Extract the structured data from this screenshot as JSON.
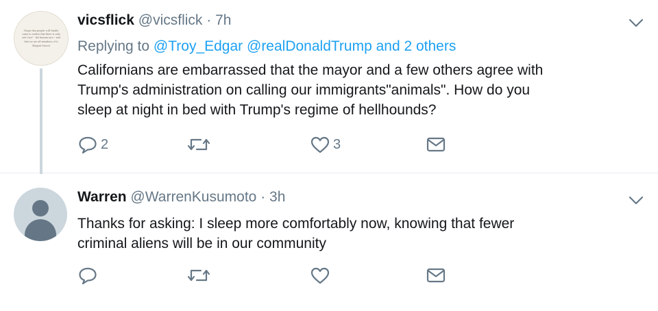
{
  "tweets": [
    {
      "name": "vicsflick",
      "handle": "@vicsflick",
      "separator": "·",
      "time": "7h",
      "replying_prefix": "Replying to",
      "replying_to": "@Troy_Edgar @realDonaldTrump and 2 others",
      "text_lines": [
        "Californians are embarrassed that the mayor and a few others agree with",
        "Trump's administration on calling our immigrants\"animals\". How do you",
        "sleep at night in bed with Trump's regime of hellhounds?"
      ],
      "avatar_quote": "I hope that people will finally come to realize that there is only one 'race' - the human race - and that we are all members of it",
      "avatar_author": "Margaret Atwood",
      "reply_count": "2",
      "retweet_count": "",
      "like_count": "3",
      "icons": [
        "reply-icon",
        "retweet-icon",
        "like-icon",
        "message-icon",
        "chevron-down-icon"
      ]
    },
    {
      "name": "Warren",
      "handle": "@WarrenKusumoto",
      "separator": "·",
      "time": "3h",
      "text_lines": [
        "Thanks for asking: I sleep more comfortably now, knowing that fewer",
        "criminal aliens will be in our community"
      ],
      "reply_count": "",
      "retweet_count": "",
      "like_count": "",
      "icons": [
        "reply-icon",
        "retweet-icon",
        "like-icon",
        "message-icon",
        "chevron-down-icon"
      ]
    }
  ],
  "colors": {
    "text": "#14171a",
    "secondary": "#657786",
    "link": "#1da1f2",
    "divider": "#e6ecf0",
    "thread_line": "#ccd6dd"
  }
}
